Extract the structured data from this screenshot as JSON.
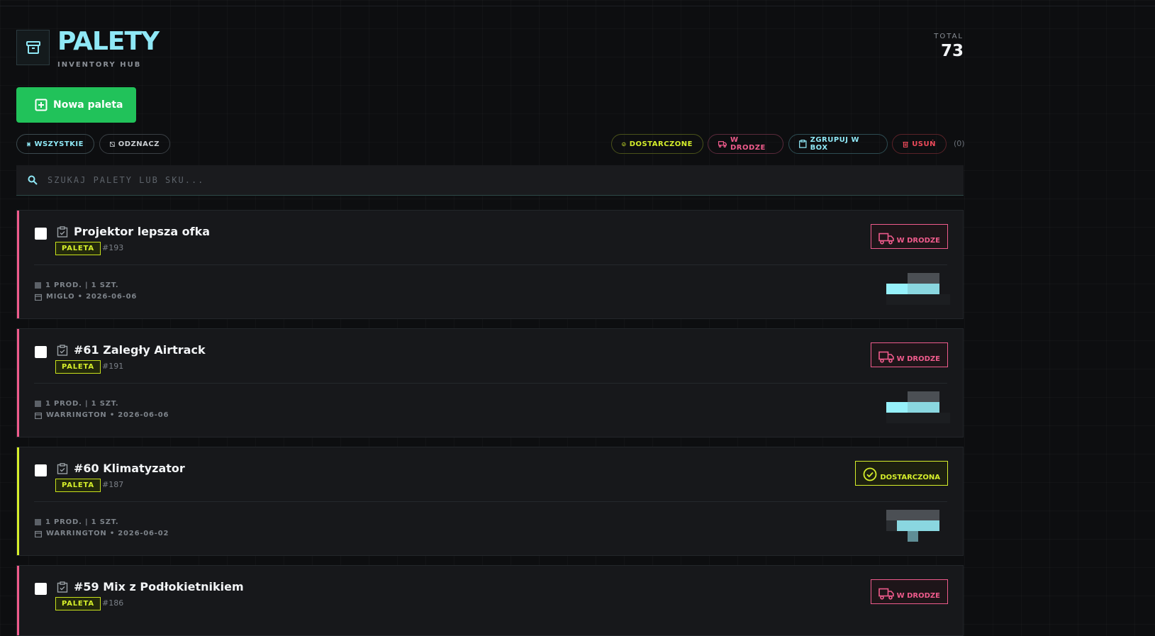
{
  "header": {
    "title": "PALETY",
    "subtitle": "INVENTORY HUB",
    "total_label": "TOTAL",
    "total_value": "73"
  },
  "new_button": {
    "label": "Nowa paleta"
  },
  "toolbar": {
    "select_all": "WSZYSTKIE",
    "deselect": "ODZNACZ",
    "delivered": "DOSTARCZONE",
    "in_transit": "W DRODZE",
    "group_box": "ZGRUPUJ W BOX",
    "delete": "USUŃ",
    "selected_count": "(0)"
  },
  "search": {
    "placeholder": "SZUKAJ PALETY LUB SKU..."
  },
  "colors": {
    "accent": "#8fe8f6",
    "green": "#21c25a",
    "in_transit": "#ef5b8c",
    "delivered": "#d6ef2b"
  },
  "pallets": [
    {
      "title": "Projektor lepsza ofka",
      "badge": "PALETA",
      "number": "#193",
      "products": "1 PROD. | 1 SZT.",
      "location": "MIGLO • 2026-06-06",
      "status": "W DRODZE"
    },
    {
      "title": "#61 Zaległy Airtrack",
      "badge": "PALETA",
      "number": "#191",
      "products": "1 PROD. | 1 SZT.",
      "location": "WARRINGTON • 2026-06-06",
      "status": "W DRODZE"
    },
    {
      "title": "#60 Klimatyzator",
      "badge": "PALETA",
      "number": "#187",
      "products": "1 PROD. | 1 SZT.",
      "location": "WARRINGTON • 2026-06-02",
      "status": "DOSTARCZONA"
    },
    {
      "title": "#59 Mix z Podłokietnikiem",
      "badge": "PALETA",
      "number": "#186",
      "products": "",
      "location": "",
      "status": "W DRODZE"
    }
  ]
}
